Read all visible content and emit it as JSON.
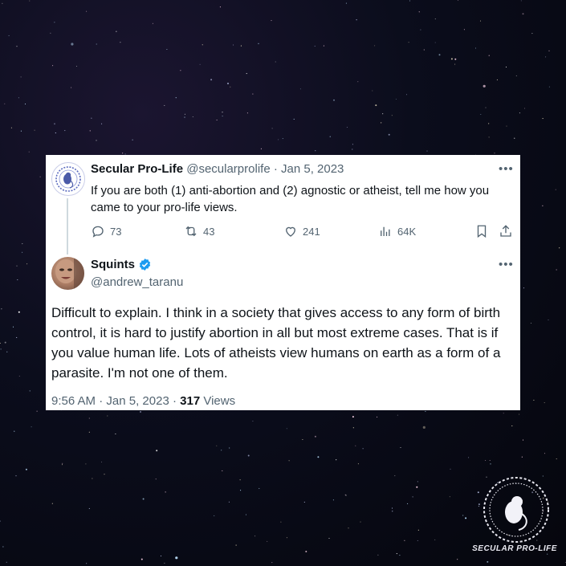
{
  "background": {
    "type": "starfield",
    "base_color": "#05060d"
  },
  "tweet_original": {
    "avatar_icon": "secular-pro-life-logo-icon",
    "name": "Secular Pro-Life",
    "handle": "@secularprolife",
    "separator": "·",
    "date": "Jan 5, 2023",
    "more_icon": "•••",
    "text": "If you are both (1) anti-abortion and (2) agnostic or atheist, tell me how you came to your pro-life views.",
    "stats": {
      "replies": "73",
      "retweets": "43",
      "likes": "241",
      "views": "64K"
    }
  },
  "tweet_reply": {
    "name": "Squints",
    "verified": true,
    "verified_color": "#1d9bf0",
    "handle": "@andrew_taranu",
    "more_icon": "•••",
    "text": "Difficult to explain. I think in a society that gives access to any form of birth control, it is hard to justify abortion in all but most extreme cases. That is if you value human life. Lots of atheists view humans on earth as a form of a parasite. I'm not one of them.",
    "time": "9:56 AM",
    "separator": "·",
    "date": "Jan 5, 2023",
    "separator2": "·",
    "views_count": "317",
    "views_label": "Views"
  },
  "watermark": {
    "text": "SECULAR PRO-LIFE"
  }
}
